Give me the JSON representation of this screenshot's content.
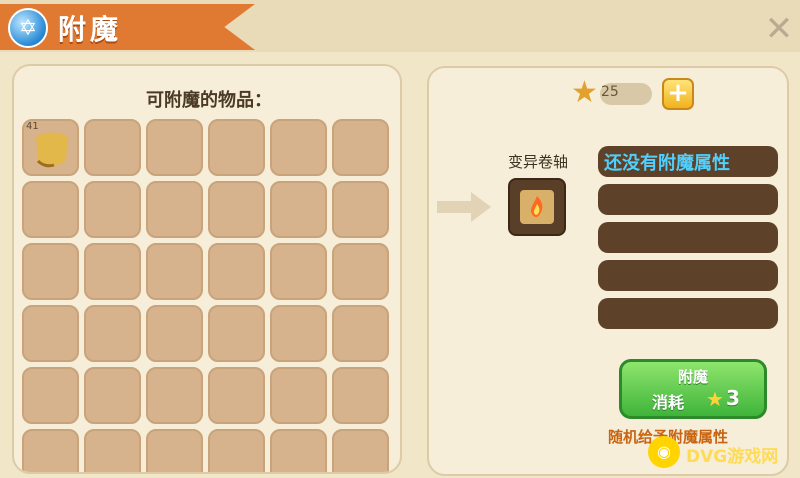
{
  "title": {
    "text": "附魔",
    "icon": "star-of-david-icon",
    "close_icon": "close-icon"
  },
  "left_panel": {
    "title": "可附魔的物品：",
    "first_item_count": "41",
    "rows": 6,
    "cols": 6
  },
  "right_panel": {
    "star_count": "25",
    "item_name": "变异卷轴",
    "attributes": [
      "还没有附魔属性",
      "",
      "",
      "",
      ""
    ],
    "enchant_button": {
      "label": "附魔",
      "cost_label": "消耗",
      "cost_value": "3"
    },
    "random_text": "随机给予附魔属性"
  },
  "watermark": {
    "text": "DVG游戏网"
  },
  "colors": {
    "ribbon": "#e07a33",
    "slot": "#d6b38c",
    "attr_bg": "#5d4128",
    "attr_text": "#4fd0ff",
    "button": "#3fb43a"
  }
}
